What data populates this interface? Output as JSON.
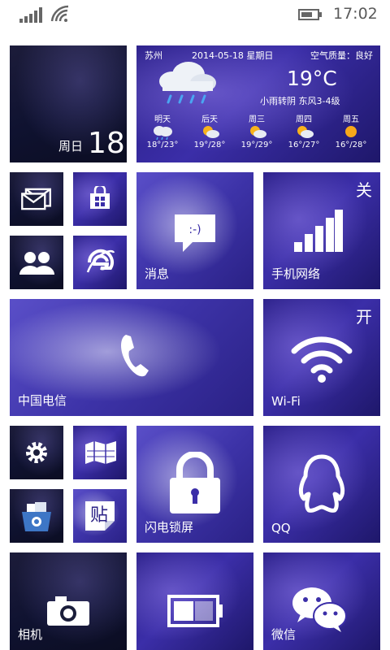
{
  "status_bar": {
    "time": "17:02",
    "signal": "signal-bars-icon",
    "wifi": "wifi-icon",
    "battery": "battery-icon"
  },
  "calendar": {
    "weekday": "周日",
    "day": "18"
  },
  "weather": {
    "city": "苏州",
    "date": "2014-05-18 星期日",
    "air_quality": "空气质量：良好",
    "temperature": "19°C",
    "condition": "小雨转阴   东风3-4级",
    "forecast": [
      {
        "day": "明天",
        "temp": "18°/23°",
        "icon": "cloud-rain-icon"
      },
      {
        "day": "后天",
        "temp": "19°/28°",
        "icon": "partly-sunny-icon"
      },
      {
        "day": "周三",
        "temp": "19°/29°",
        "icon": "partly-sunny-icon"
      },
      {
        "day": "周四",
        "temp": "16°/27°",
        "icon": "partly-sunny-icon"
      },
      {
        "day": "周五",
        "temp": "16°/28°",
        "icon": "sun-icon"
      }
    ]
  },
  "tiles": {
    "messaging": {
      "label": "消息"
    },
    "mobile_network": {
      "label": "手机网络",
      "state": "关"
    },
    "phone": {
      "label": "中国电信"
    },
    "wifi": {
      "label": "Wi-Fi",
      "state": "开"
    },
    "flashlight": {
      "label": "闪电锁屏"
    },
    "qq": {
      "label": "QQ"
    },
    "camera": {
      "label": "相机"
    },
    "wechat": {
      "label": "微信"
    }
  }
}
